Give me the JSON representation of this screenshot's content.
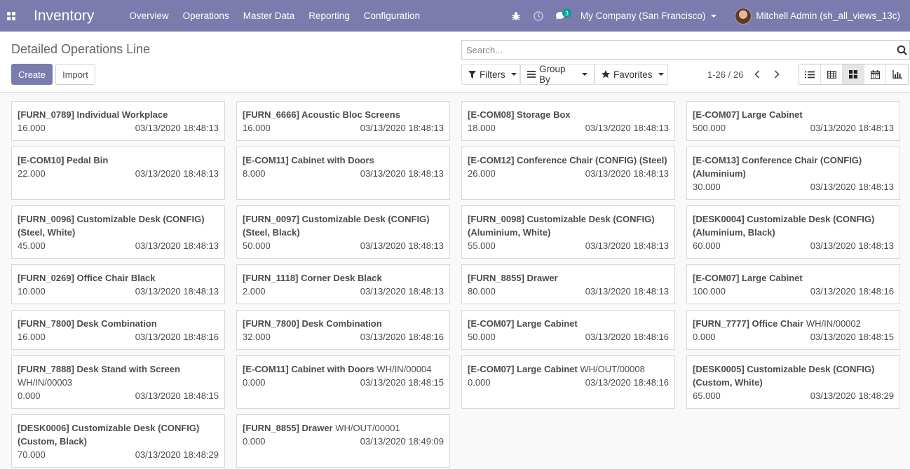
{
  "navbar": {
    "brand": "Inventory",
    "menu": [
      "Overview",
      "Operations",
      "Master Data",
      "Reporting",
      "Configuration"
    ],
    "messages_count": "3",
    "company": "My Company (San Francisco)",
    "user": "Mitchell Admin (sh_all_views_13c)",
    "accent_color": "#7c7bad"
  },
  "control": {
    "title": "Detailed Operations Line",
    "create_label": "Create",
    "import_label": "Import",
    "search_placeholder": "Search...",
    "filters_label": "Filters",
    "groupby_label": "Group By",
    "favorites_label": "Favorites",
    "pager": "1-26 / 26",
    "active_view": "kanban"
  },
  "cards": [
    {
      "product": "[FURN_0789] Individual Workplace",
      "ref": "",
      "qty": "16.000",
      "date": "03/13/2020 18:48:13"
    },
    {
      "product": "[FURN_6666] Acoustic Bloc Screens",
      "ref": "",
      "qty": "16.000",
      "date": "03/13/2020 18:48:13"
    },
    {
      "product": "[E-COM08] Storage Box",
      "ref": "",
      "qty": "18.000",
      "date": "03/13/2020 18:48:13"
    },
    {
      "product": "[E-COM07] Large Cabinet",
      "ref": "",
      "qty": "500.000",
      "date": "03/13/2020 18:48:13"
    },
    {
      "product": "[E-COM10] Pedal Bin",
      "ref": "",
      "qty": "22.000",
      "date": "03/13/2020 18:48:13"
    },
    {
      "product": "[E-COM11] Cabinet with Doors",
      "ref": "",
      "qty": "8.000",
      "date": "03/13/2020 18:48:13"
    },
    {
      "product": "[E-COM12] Conference Chair (CONFIG) (Steel)",
      "ref": "",
      "qty": "26.000",
      "date": "03/13/2020 18:48:13"
    },
    {
      "product": "[E-COM13] Conference Chair (CONFIG) (Aluminium)",
      "ref": "",
      "qty": "30.000",
      "date": "03/13/2020 18:48:13"
    },
    {
      "product": "[FURN_0096] Customizable Desk (CONFIG) (Steel, White)",
      "ref": "",
      "qty": "45.000",
      "date": "03/13/2020 18:48:13"
    },
    {
      "product": "[FURN_0097] Customizable Desk (CONFIG) (Steel, Black)",
      "ref": "",
      "qty": "50.000",
      "date": "03/13/2020 18:48:13"
    },
    {
      "product": "[FURN_0098] Customizable Desk (CONFIG) (Aluminium, White)",
      "ref": "",
      "qty": "55.000",
      "date": "03/13/2020 18:48:13"
    },
    {
      "product": "[DESK0004] Customizable Desk (CONFIG) (Aluminium, Black)",
      "ref": "",
      "qty": "60.000",
      "date": "03/13/2020 18:48:13"
    },
    {
      "product": "[FURN_0269] Office Chair Black",
      "ref": "",
      "qty": "10.000",
      "date": "03/13/2020 18:48:13"
    },
    {
      "product": "[FURN_1118] Corner Desk Black",
      "ref": "",
      "qty": "2.000",
      "date": "03/13/2020 18:48:13"
    },
    {
      "product": "[FURN_8855] Drawer",
      "ref": "",
      "qty": "80.000",
      "date": "03/13/2020 18:48:13"
    },
    {
      "product": "[E-COM07] Large Cabinet",
      "ref": "",
      "qty": "100.000",
      "date": "03/13/2020 18:48:16"
    },
    {
      "product": "[FURN_7800] Desk Combination",
      "ref": "",
      "qty": "16.000",
      "date": "03/13/2020 18:48:16"
    },
    {
      "product": "[FURN_7800] Desk Combination",
      "ref": "",
      "qty": "32.000",
      "date": "03/13/2020 18:48:16"
    },
    {
      "product": "[E-COM07] Large Cabinet",
      "ref": "",
      "qty": "50.000",
      "date": "03/13/2020 18:48:16"
    },
    {
      "product": "[FURN_7777] Office Chair",
      "ref": "WH/IN/00002",
      "qty": "0.000",
      "date": "03/13/2020 18:48:15"
    },
    {
      "product": "[FURN_7888] Desk Stand with Screen",
      "ref": "WH/IN/00003",
      "qty": "0.000",
      "date": "03/13/2020 18:48:15"
    },
    {
      "product": "[E-COM11] Cabinet with Doors",
      "ref": "WH/IN/00004",
      "qty": "0.000",
      "date": "03/13/2020 18:48:15"
    },
    {
      "product": "[E-COM07] Large Cabinet",
      "ref": "WH/OUT/00008",
      "qty": "0.000",
      "date": "03/13/2020 18:48:16"
    },
    {
      "product": "[DESK0005] Customizable Desk (CONFIG) (Custom, White)",
      "ref": "",
      "qty": "65.000",
      "date": "03/13/2020 18:48:29"
    },
    {
      "product": "[DESK0006] Customizable Desk (CONFIG) (Custom, Black)",
      "ref": "",
      "qty": "70.000",
      "date": "03/13/2020 18:48:29"
    },
    {
      "product": "[FURN_8855] Drawer",
      "ref": "WH/OUT/00001",
      "qty": "0.000",
      "date": "03/13/2020 18:49:09"
    }
  ]
}
